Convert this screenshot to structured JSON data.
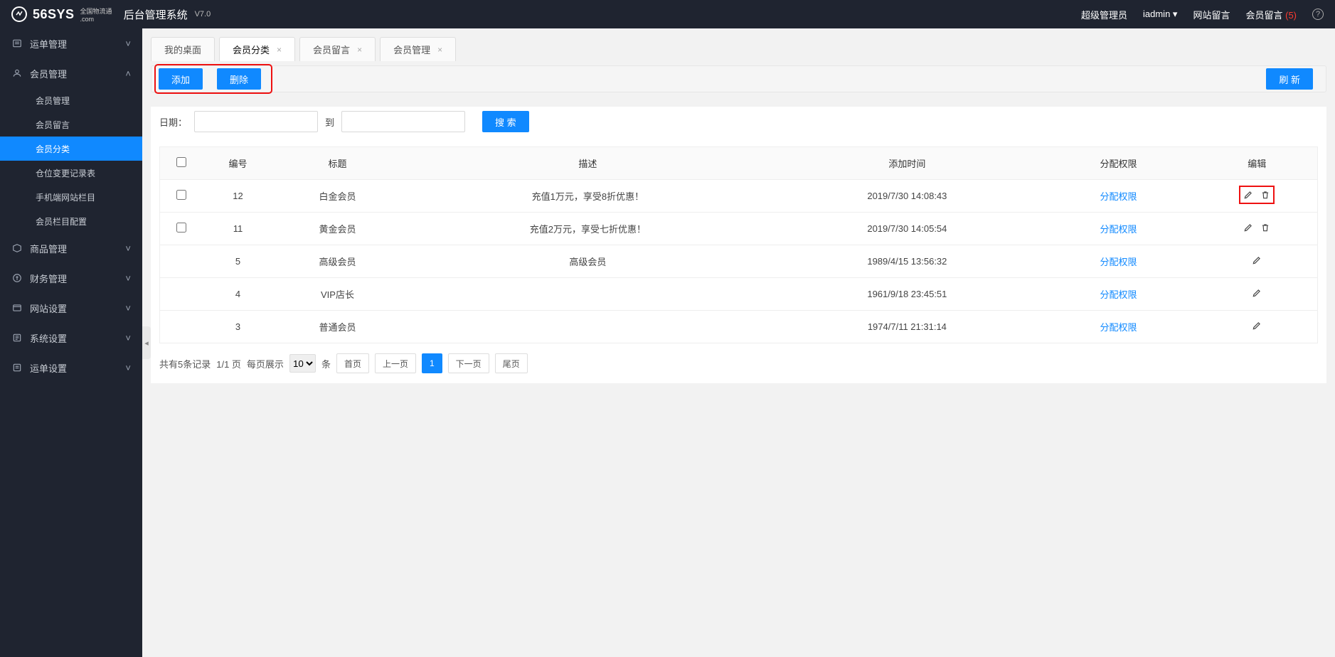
{
  "header": {
    "logo_main": "56SYS",
    "logo_sub_top": "全国物流通",
    "logo_sub_bottom": ".com",
    "sys_title": "后台管理系统",
    "version": "V7.0",
    "role": "超级管理员",
    "user": "iadmin",
    "nav_site_msg": "网站留言",
    "nav_member_msg": "会员留言",
    "nav_member_msg_count": "(5)"
  },
  "sidebar": {
    "items": [
      {
        "label": "运单管理",
        "expanded": false
      },
      {
        "label": "会员管理",
        "expanded": true,
        "children": [
          {
            "label": "会员管理"
          },
          {
            "label": "会员留言"
          },
          {
            "label": "会员分类",
            "active": true
          },
          {
            "label": "仓位变更记录表"
          },
          {
            "label": "手机端网站栏目"
          },
          {
            "label": "会员栏目配置"
          }
        ]
      },
      {
        "label": "商品管理",
        "expanded": false
      },
      {
        "label": "财务管理",
        "expanded": false
      },
      {
        "label": "网站设置",
        "expanded": false
      },
      {
        "label": "系统设置",
        "expanded": false
      },
      {
        "label": "运单设置",
        "expanded": false
      }
    ]
  },
  "tabs": [
    {
      "label": "我的桌面",
      "closable": false
    },
    {
      "label": "会员分类",
      "closable": true,
      "active": true
    },
    {
      "label": "会员留言",
      "closable": true
    },
    {
      "label": "会员管理",
      "closable": true
    }
  ],
  "toolbar": {
    "add": "添加",
    "delete": "删除",
    "refresh": "刷 新"
  },
  "search": {
    "date_label": "日期：",
    "to": "到",
    "btn": "搜 索"
  },
  "table": {
    "cols": [
      "",
      "编号",
      "标题",
      "描述",
      "添加时间",
      "分配权限",
      "编辑"
    ],
    "assign_label": "分配权限",
    "rows": [
      {
        "id": "12",
        "title": "白金会员",
        "desc": "充值1万元，享受8折优惠！",
        "time": "2019/7/30 14:08:43",
        "checkbox": true,
        "deletable": true,
        "highlight": true
      },
      {
        "id": "11",
        "title": "黄金会员",
        "desc": "充值2万元，享受七折优惠！",
        "time": "2019/7/30 14:05:54",
        "checkbox": true,
        "deletable": true
      },
      {
        "id": "5",
        "title": "高级会员",
        "desc": "高级会员",
        "time": "1989/4/15 13:56:32",
        "checkbox": false,
        "deletable": false
      },
      {
        "id": "4",
        "title": "VIP店长",
        "desc": "",
        "time": "1961/9/18 23:45:51",
        "checkbox": false,
        "deletable": false
      },
      {
        "id": "3",
        "title": "普通会员",
        "desc": "",
        "time": "1974/7/11 21:31:14",
        "checkbox": false,
        "deletable": false
      }
    ]
  },
  "pager": {
    "summary": "共有5条记录",
    "pages": "1/1 页",
    "per_label": "每页展示",
    "per_value": "10",
    "unit": "条",
    "first": "首页",
    "prev": "上一页",
    "cur": "1",
    "next": "下一页",
    "last": "尾页"
  }
}
